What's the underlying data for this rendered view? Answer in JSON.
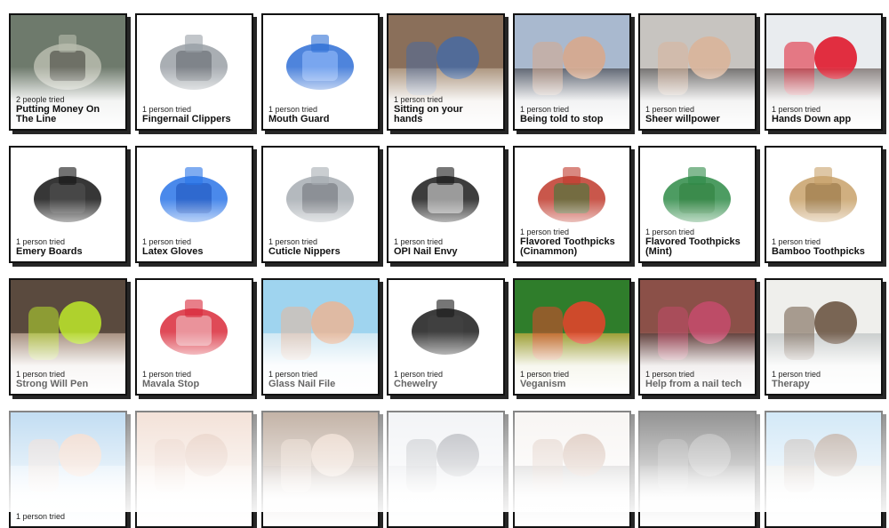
{
  "cards": [
    {
      "row": 0,
      "col": 0,
      "tried": "2 people tried",
      "title": "Putting Money On\nThe Line",
      "icon": "money-chain-lock-icon",
      "c1": "#6e7a6c",
      "c2": "#b8bcae",
      "c3": "#3b3b33"
    },
    {
      "row": 0,
      "col": 1,
      "tried": "1 person tried",
      "title": "Fingernail Clippers",
      "icon": "nail-clipper-icon",
      "c1": "#ffffff",
      "c2": "#9aa0a6",
      "c3": "#5d6268"
    },
    {
      "row": 0,
      "col": 2,
      "tried": "1 person tried",
      "title": "Mouth Guard",
      "icon": "mouth-guard-icon",
      "c1": "#ffffff",
      "c2": "#2f6fd6",
      "c3": "#9cc3ff"
    },
    {
      "row": 0,
      "col": 3,
      "tried": "1 person tried",
      "title": "Sitting on your\nhands",
      "icon": "sitting-hands-photo",
      "c1": "#8a6f5a",
      "c2": "#4a6a9e",
      "c3": "#c9b29a"
    },
    {
      "row": 0,
      "col": 4,
      "tried": "1 person tried",
      "title": "Being told to stop",
      "icon": "stop-hand-photo",
      "c1": "#a9b9cf",
      "c2": "#d7a98c",
      "c3": "#1e1e22"
    },
    {
      "row": 0,
      "col": 5,
      "tried": "1 person tried",
      "title": "Sheer willpower",
      "icon": "students-photo",
      "c1": "#c7c4c0",
      "c2": "#d9b59a",
      "c3": "#2a2a2a"
    },
    {
      "row": 0,
      "col": 6,
      "tried": "1 person tried",
      "title": "Hands Down app",
      "icon": "app-alert-photo",
      "c1": "#e9ecef",
      "c2": "#e0192c",
      "c3": "#3a2c25"
    },
    {
      "row": 1,
      "col": 0,
      "tried": "1 person tried",
      "title": "Emery Boards",
      "icon": "emery-boards-icon",
      "c1": "#ffffff",
      "c2": "#141414",
      "c3": "#555555"
    },
    {
      "row": 1,
      "col": 1,
      "tried": "1 person tried",
      "title": "Latex Gloves",
      "icon": "gloves-icon",
      "c1": "#ffffff",
      "c2": "#2a74e8",
      "c3": "#1a4fb8"
    },
    {
      "row": 1,
      "col": 2,
      "tried": "1 person tried",
      "title": "Cuticle Nippers",
      "icon": "cuticle-nippers-icon",
      "c1": "#ffffff",
      "c2": "#a7adb3",
      "c3": "#6b7075"
    },
    {
      "row": 1,
      "col": 3,
      "tried": "1 person tried",
      "title": "OPI Nail Envy",
      "icon": "nail-polish-icon",
      "c1": "#ffffff",
      "c2": "#1b1b1b",
      "c3": "#eaeaea"
    },
    {
      "row": 1,
      "col": 4,
      "tried": "1 person tried",
      "title": "Flavored Toothpicks\n(Cinammon)",
      "icon": "toothpick-box-cinnamon-icon",
      "c1": "#ffffff",
      "c2": "#c0392b",
      "c3": "#2e7d3b"
    },
    {
      "row": 1,
      "col": 5,
      "tried": "1 person tried",
      "title": "Flavored Toothpicks\n(Mint)",
      "icon": "toothpick-box-mint-icon",
      "c1": "#ffffff",
      "c2": "#2e8b47",
      "c3": "#2e7d3b"
    },
    {
      "row": 1,
      "col": 6,
      "tried": "1 person tried",
      "title": "Bamboo Toothpicks",
      "icon": "toothpick-jars-icon",
      "c1": "#ffffff",
      "c2": "#c8a16a",
      "c3": "#8e6b3a"
    },
    {
      "row": 2,
      "col": 0,
      "tried": "1 person tried",
      "title": "Strong Will Pen",
      "icon": "pen-finger-photo",
      "c1": "#5a4a3e",
      "c2": "#b8e02b",
      "c3": "#e5c7b0",
      "dim": true
    },
    {
      "row": 2,
      "col": 1,
      "tried": "1 person tried",
      "title": "Mavala Stop",
      "icon": "mavala-box-icon",
      "c1": "#ffffff",
      "c2": "#d92a3a",
      "c3": "#f2d0d4",
      "dim": true
    },
    {
      "row": 2,
      "col": 2,
      "tried": "1 person tried",
      "title": "Glass Nail File",
      "icon": "glass-file-photo",
      "c1": "#9fd4ef",
      "c2": "#e6b79a",
      "c3": "#f5f5f5",
      "dim": true
    },
    {
      "row": 2,
      "col": 3,
      "tried": "1 person tried",
      "title": "Chewelry",
      "icon": "chew-necklace-icon",
      "c1": "#ffffff",
      "c2": "#1a1a1a",
      "c3": "#444444",
      "dim": true
    },
    {
      "row": 2,
      "col": 4,
      "tried": "1 person tried",
      "title": "Veganism",
      "icon": "vegetables-photo",
      "c1": "#2f7d2b",
      "c2": "#e0452b",
      "c3": "#f2b632",
      "dim": true
    },
    {
      "row": 2,
      "col": 5,
      "tried": "1 person tried",
      "title": "Help from a nail tech",
      "icon": "nail-tech-photo",
      "c1": "#8b5048",
      "c2": "#c24b6a",
      "c3": "#3a2a2a",
      "dim": true
    },
    {
      "row": 2,
      "col": 6,
      "tried": "1 person tried",
      "title": "Therapy",
      "icon": "therapy-room-photo",
      "c1": "#efefec",
      "c2": "#6b5544",
      "c3": "#a9b0b3",
      "dim": true
    },
    {
      "row": 3,
      "col": 0,
      "tried": "1 person tried",
      "title": "",
      "icon": "finger-sky-photo",
      "c1": "#88bde6",
      "c2": "#e8b395",
      "c3": "#cfe7f7",
      "dim": true
    },
    {
      "row": 3,
      "col": 1,
      "tried": "",
      "title": "",
      "icon": "hand-photo",
      "c1": "#e8c6b3",
      "c2": "#cf9e86",
      "c3": "#f4e0d3",
      "dim": true
    },
    {
      "row": 3,
      "col": 2,
      "tried": "",
      "title": "",
      "icon": "hands-massage-photo",
      "c1": "#8a6a52",
      "c2": "#d8b49a",
      "c3": "#5e4636",
      "dim": true
    },
    {
      "row": 3,
      "col": 3,
      "tried": "",
      "title": "",
      "icon": "office-person-photo",
      "c1": "#e6e9ee",
      "c2": "#6a6f7a",
      "c3": "#b7bcc6",
      "dim": true
    },
    {
      "row": 3,
      "col": 4,
      "tried": "",
      "title": "",
      "icon": "couple-photo",
      "c1": "#f1ece8",
      "c2": "#b58a72",
      "c3": "#4f4f4f",
      "dim": true
    },
    {
      "row": 3,
      "col": 5,
      "tried": "",
      "title": "",
      "icon": "dark-hand-photo",
      "c1": "#2b2b2b",
      "c2": "#6d6d6d",
      "c3": "#444444",
      "dim": true
    },
    {
      "row": 3,
      "col": 6,
      "tried": "",
      "title": "",
      "icon": "beach-woman-photo",
      "c1": "#a9d3ef",
      "c2": "#7b5a44",
      "c3": "#e9d9be",
      "dim": true
    }
  ]
}
